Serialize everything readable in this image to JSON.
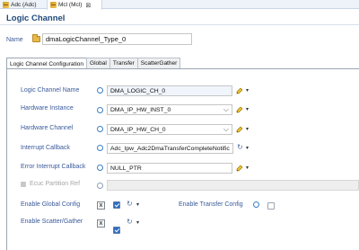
{
  "editor_tabs": [
    {
      "label": "Adc (Adc)"
    },
    {
      "label": "Mcl (Mcl)",
      "close": "⊠"
    }
  ],
  "header": {
    "title": "Logic Channel"
  },
  "name": {
    "label": "Name",
    "value": "dmaLogicChannel_Type_0"
  },
  "form_tabs": [
    {
      "label": "Logic Channel Configuration"
    },
    {
      "label": "Global"
    },
    {
      "label": "Transfer"
    },
    {
      "label": "ScatterGather"
    }
  ],
  "fields": {
    "logic_channel_name": {
      "label": "Logic Channel Name",
      "value": "DMA_LOGIC_CH_0"
    },
    "hardware_instance": {
      "label": "Hardware Instance",
      "value": "DMA_IP_HW_INST_0"
    },
    "hardware_channel": {
      "label": "Hardware Channel",
      "value": "DMA_IP_HW_CH_0"
    },
    "interrupt_callback": {
      "label": "Interrupt Callback",
      "value": "Adc_Ipw_Adc2DmaTransferCompleteNotific"
    },
    "error_interrupt_callback": {
      "label": "Error Interrupt Callback",
      "value": "NULL_PTR"
    },
    "ecuc_partition_ref": {
      "label": "Ecuc Partition Ref",
      "value": ""
    },
    "enable_global_config": {
      "label": "Enable Global Config"
    },
    "enable_transfer_config": {
      "label": "Enable Transfer Config"
    },
    "enable_scatter_gather": {
      "label": "Enable Scatter/Gather"
    }
  },
  "icons": {
    "dropdown": "▾",
    "combo_chevron": "⌵",
    "x_badge": "X",
    "swirl": "↻"
  }
}
